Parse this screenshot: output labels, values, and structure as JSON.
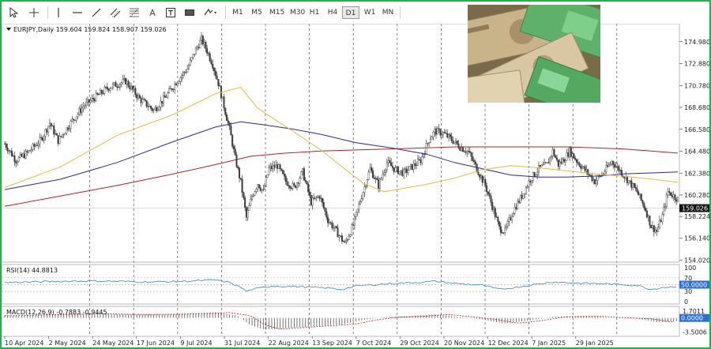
{
  "toolbar": {
    "timeframes": [
      "M1",
      "M5",
      "M15",
      "M30",
      "H1",
      "H4",
      "D1",
      "W1",
      "MN"
    ],
    "active_timeframe": "D1",
    "text_tool": "A"
  },
  "colors": {
    "frame": "#22b14c",
    "bull": "#3a3a3a",
    "bear": "#3a3a3a",
    "ma_fast": "#e8b84a",
    "ma_mid": "#2a2a9a",
    "ma_slow": "#b22222",
    "rsi": "#4a90c8",
    "macd_hist": "#555555",
    "macd_signal": "#c02020"
  },
  "chart_data": {
    "type": "candlestick",
    "symbol_header": "EURJPY,Daily  159.604 159.824 158.907 159.026",
    "last_price_label": "159.026",
    "last_price": 159.026,
    "ylim": [
      154.0,
      176.4
    ],
    "y_ticks": [
      "174.980",
      "172.880",
      "170.780",
      "168.680",
      "166.580",
      "164.480",
      "162.380",
      "160.280",
      "158.224",
      "156.140",
      "154.020"
    ],
    "x_ticks": [
      "10 Apr 2024",
      "2 May 2024",
      "24 May 2024",
      "17 Jun 2024",
      "9 Jul 2024",
      "31 Jul 2024",
      "22 Aug 2024",
      "13 Sep 2024",
      "7 Oct 2024",
      "29 Oct 2024",
      "20 Nov 2024",
      "12 Dec 2024",
      "7 Jan 2025",
      "29 Jan 2025"
    ],
    "path_anchors": [
      [
        0,
        165.2
      ],
      [
        8,
        163.6
      ],
      [
        16,
        164.3
      ],
      [
        26,
        165.6
      ],
      [
        32,
        167.2
      ],
      [
        38,
        165.5
      ],
      [
        48,
        167.4
      ],
      [
        56,
        168.8
      ],
      [
        64,
        169.6
      ],
      [
        74,
        170.6
      ],
      [
        86,
        171.2
      ],
      [
        96,
        169.5
      ],
      [
        106,
        168.4
      ],
      [
        114,
        169.6
      ],
      [
        122,
        171.1
      ],
      [
        130,
        172.4
      ],
      [
        136,
        174.2
      ],
      [
        140,
        175.2
      ],
      [
        144,
        174.1
      ],
      [
        148,
        172.8
      ],
      [
        152,
        171.0
      ],
      [
        156,
        168.8
      ],
      [
        160,
        166.6
      ],
      [
        164,
        163.8
      ],
      [
        168,
        161.5
      ],
      [
        172,
        158.1
      ],
      [
        176,
        160.2
      ],
      [
        180,
        161.4
      ],
      [
        184,
        160.6
      ],
      [
        188,
        162.8
      ],
      [
        194,
        163.1
      ],
      [
        200,
        161.6
      ],
      [
        206,
        161.0
      ],
      [
        212,
        162.5
      ],
      [
        218,
        159.6
      ],
      [
        224,
        160.2
      ],
      [
        230,
        157.9
      ],
      [
        236,
        156.8
      ],
      [
        242,
        155.6
      ],
      [
        248,
        157.4
      ],
      [
        254,
        160.2
      ],
      [
        260,
        162.8
      ],
      [
        266,
        161.2
      ],
      [
        272,
        163.4
      ],
      [
        278,
        162.7
      ],
      [
        284,
        162.4
      ],
      [
        290,
        163.0
      ],
      [
        296,
        163.6
      ],
      [
        302,
        165.6
      ],
      [
        306,
        166.4
      ],
      [
        312,
        166.2
      ],
      [
        318,
        165.6
      ],
      [
        324,
        164.9
      ],
      [
        330,
        164.4
      ],
      [
        336,
        162.8
      ],
      [
        342,
        161.2
      ],
      [
        348,
        158.8
      ],
      [
        352,
        157.1
      ],
      [
        356,
        156.8
      ],
      [
        362,
        158.8
      ],
      [
        368,
        160.2
      ],
      [
        374,
        161.8
      ],
      [
        380,
        162.8
      ],
      [
        386,
        163.2
      ],
      [
        390,
        164.5
      ],
      [
        394,
        163.2
      ],
      [
        398,
        163.7
      ],
      [
        402,
        164.5
      ],
      [
        408,
        163.4
      ],
      [
        414,
        162.5
      ],
      [
        420,
        161.6
      ],
      [
        426,
        162.4
      ],
      [
        432,
        163.5
      ],
      [
        438,
        162.6
      ],
      [
        444,
        161.6
      ],
      [
        450,
        160.6
      ],
      [
        456,
        158.9
      ],
      [
        460,
        157.3
      ],
      [
        464,
        156.8
      ],
      [
        468,
        158.3
      ],
      [
        472,
        160.6
      ],
      [
        476,
        160.2
      ],
      [
        479,
        159.9
      ]
    ],
    "ma_fast": [
      [
        0,
        161.0
      ],
      [
        40,
        163.0
      ],
      [
        80,
        166.0
      ],
      [
        120,
        168.0
      ],
      [
        150,
        170.0
      ],
      [
        168,
        170.6
      ],
      [
        180,
        168.6
      ],
      [
        205,
        166.4
      ],
      [
        225,
        164.6
      ],
      [
        240,
        163.0
      ],
      [
        255,
        161.4
      ],
      [
        270,
        160.6
      ],
      [
        300,
        161.3
      ],
      [
        320,
        161.9
      ],
      [
        340,
        162.7
      ],
      [
        360,
        163.1
      ],
      [
        380,
        162.9
      ],
      [
        400,
        162.6
      ],
      [
        420,
        162.3
      ],
      [
        440,
        162.1
      ],
      [
        460,
        161.8
      ],
      [
        479,
        161.5
      ]
    ],
    "ma_mid": [
      [
        0,
        160.8
      ],
      [
        40,
        161.8
      ],
      [
        80,
        163.4
      ],
      [
        120,
        165.4
      ],
      [
        150,
        166.8
      ],
      [
        168,
        167.3
      ],
      [
        185,
        167.0
      ],
      [
        205,
        166.6
      ],
      [
        225,
        166.1
      ],
      [
        250,
        165.3
      ],
      [
        275,
        164.8
      ],
      [
        300,
        164.2
      ],
      [
        320,
        163.4
      ],
      [
        340,
        162.8
      ],
      [
        360,
        162.2
      ],
      [
        380,
        162.0
      ],
      [
        400,
        162.0
      ],
      [
        420,
        162.1
      ],
      [
        440,
        162.3
      ],
      [
        460,
        162.4
      ],
      [
        479,
        162.5
      ]
    ],
    "ma_slow": [
      [
        0,
        159.2
      ],
      [
        40,
        160.2
      ],
      [
        80,
        161.2
      ],
      [
        120,
        162.3
      ],
      [
        150,
        163.2
      ],
      [
        175,
        164.0
      ],
      [
        200,
        164.3
      ],
      [
        225,
        164.5
      ],
      [
        250,
        164.6
      ],
      [
        275,
        164.7
      ],
      [
        300,
        164.8
      ],
      [
        320,
        164.9
      ],
      [
        340,
        164.9
      ],
      [
        360,
        164.9
      ],
      [
        380,
        164.9
      ],
      [
        400,
        164.9
      ],
      [
        420,
        164.8
      ],
      [
        440,
        164.7
      ],
      [
        460,
        164.5
      ],
      [
        479,
        164.3
      ]
    ],
    "rsi": {
      "label": "RSI(14) 44.8813",
      "value": 44.8813,
      "levels": [
        "70",
        "50.0000",
        "30"
      ],
      "ticks": [
        "100",
        "70",
        "50.0000",
        "30",
        "0"
      ],
      "ylim": [
        0,
        100
      ],
      "path": [
        [
          0,
          56
        ],
        [
          20,
          58
        ],
        [
          40,
          60
        ],
        [
          60,
          61
        ],
        [
          80,
          60
        ],
        [
          100,
          58
        ],
        [
          120,
          59
        ],
        [
          140,
          62
        ],
        [
          150,
          64
        ],
        [
          160,
          56
        ],
        [
          168,
          42
        ],
        [
          172,
          30
        ],
        [
          176,
          36
        ],
        [
          190,
          46
        ],
        [
          210,
          44
        ],
        [
          230,
          40
        ],
        [
          240,
          36
        ],
        [
          250,
          46
        ],
        [
          270,
          52
        ],
        [
          290,
          56
        ],
        [
          306,
          60
        ],
        [
          320,
          54
        ],
        [
          340,
          48
        ],
        [
          352,
          36
        ],
        [
          360,
          40
        ],
        [
          380,
          52
        ],
        [
          390,
          58
        ],
        [
          410,
          54
        ],
        [
          430,
          52
        ],
        [
          450,
          48
        ],
        [
          460,
          36
        ],
        [
          468,
          42
        ],
        [
          479,
          44.9
        ]
      ]
    },
    "macd": {
      "label": "MACD(12,26,9) -0.7883 -0.9445",
      "macd_value": -0.7883,
      "signal_value": -0.9445,
      "ticks": [
        "1.7011",
        "0.0000",
        "-3.5006"
      ],
      "ylim": [
        -4.2,
        2.3
      ],
      "path": [
        [
          0,
          0.6
        ],
        [
          30,
          0.9
        ],
        [
          60,
          1.1
        ],
        [
          90,
          0.9
        ],
        [
          120,
          1.0
        ],
        [
          150,
          1.4
        ],
        [
          165,
          0.6
        ],
        [
          175,
          -1.8
        ],
        [
          185,
          -2.9
        ],
        [
          200,
          -2.6
        ],
        [
          220,
          -2.1
        ],
        [
          240,
          -1.6
        ],
        [
          255,
          -0.5
        ],
        [
          270,
          0.2
        ],
        [
          290,
          0.5
        ],
        [
          306,
          0.9
        ],
        [
          320,
          0.4
        ],
        [
          340,
          -0.4
        ],
        [
          355,
          -1.4
        ],
        [
          370,
          -0.8
        ],
        [
          390,
          0.3
        ],
        [
          410,
          0.5
        ],
        [
          430,
          0.1
        ],
        [
          450,
          -0.2
        ],
        [
          465,
          -1.1
        ],
        [
          479,
          -0.79
        ]
      ]
    }
  }
}
